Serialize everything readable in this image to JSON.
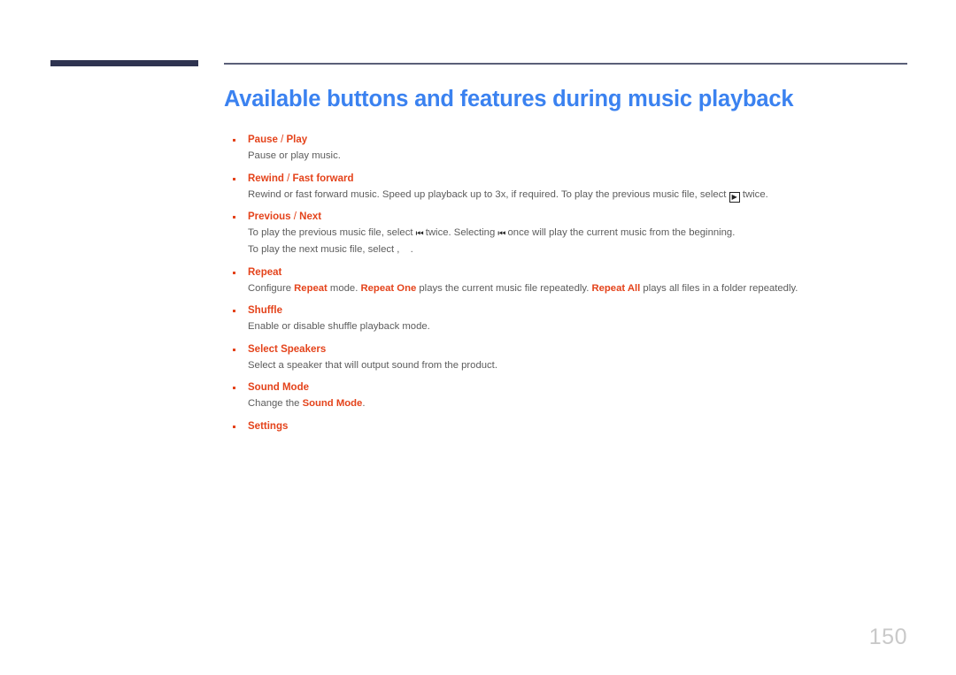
{
  "document": {
    "page_number": "150",
    "title": "Available buttons and features during music playback",
    "colors": {
      "title_blue": "#3b82f0",
      "accent_orange": "#e4431b",
      "body_gray": "#5c5c5c",
      "rule_navy": "#2e3350",
      "rule_thin": "#5a5f78",
      "page_number_gray": "#c9c9c9"
    }
  },
  "features": [
    {
      "id": "pause-play",
      "label_primary": "Pause",
      "separator": " / ",
      "label_secondary": "Play",
      "description": "Pause or play music."
    },
    {
      "id": "rewind-fast-forward",
      "label_primary": "Rewind",
      "separator": " / ",
      "label_secondary": "Fast forward",
      "description_part1": "Rewind or fast forward music. Speed up playback up to 3x, if required. To play the previous music file, select ",
      "icon_play_boxed": "▶",
      "description_part2": " twice."
    },
    {
      "id": "previous-next",
      "label_primary": "Previous",
      "separator": " / ",
      "label_secondary": "Next",
      "line1_part1": "To play the previous music file, select ",
      "icon_previous": "⏮",
      "line1_part2": " twice. Selecting ",
      "icon_previous_2": "⏮",
      "line1_part3": " once will play the current music from the beginning.",
      "line2_part1": "To play the next music file, select , ",
      "line2_part2": "."
    },
    {
      "id": "repeat",
      "label_primary": "Repeat",
      "desc_part1": "Configure ",
      "desc_hl1": "Repeat",
      "desc_part2": " mode. ",
      "desc_hl2": "Repeat One",
      "desc_part3": " plays the current music file repeatedly. ",
      "desc_hl3": "Repeat All",
      "desc_part4": " plays all files in a folder repeatedly."
    },
    {
      "id": "shuffle",
      "label_primary": "Shuffle",
      "description": "Enable or disable shuffle playback mode."
    },
    {
      "id": "select-speakers",
      "label_primary": "Select Speakers",
      "description": "Select a speaker that will output sound from the product."
    },
    {
      "id": "sound-mode",
      "label_primary": "Sound Mode",
      "desc_part1": "Change the ",
      "desc_hl1": "Sound Mode",
      "desc_part2": "."
    },
    {
      "id": "settings",
      "label_primary": "Settings",
      "description": ""
    }
  ]
}
